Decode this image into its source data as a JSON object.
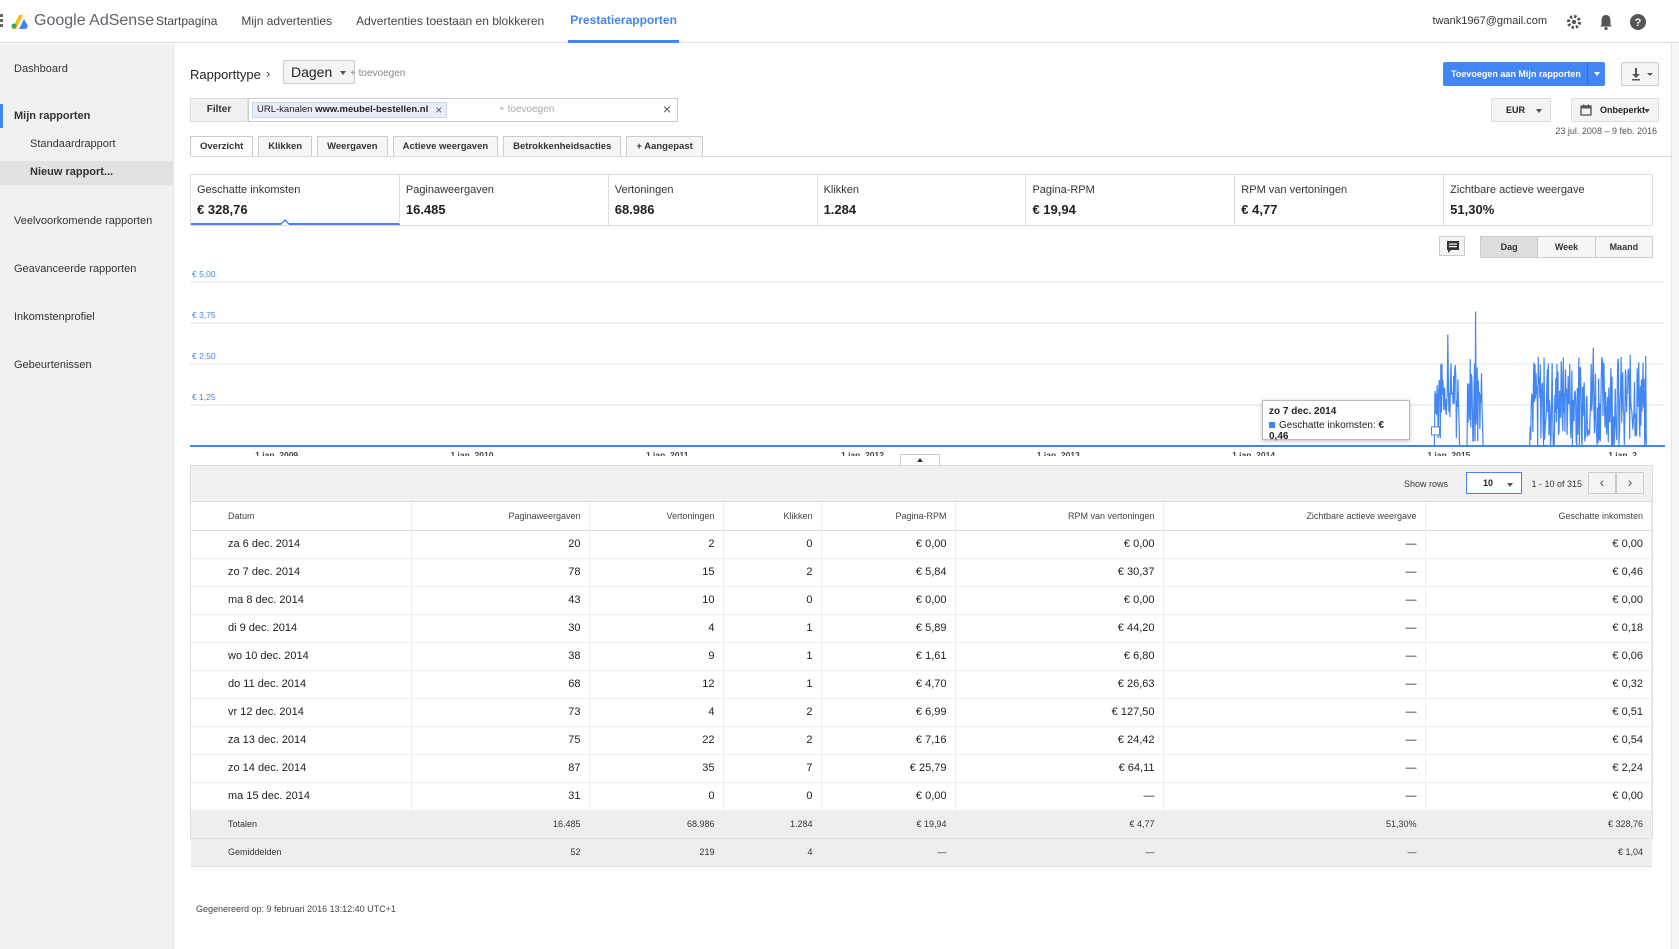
{
  "app": {
    "logo": "Google AdSense",
    "logo_icon": "adsense-logo-icon"
  },
  "nav": [
    {
      "label": "Startpagina",
      "active": false
    },
    {
      "label": "Mijn advertenties",
      "active": false
    },
    {
      "label": "Advertenties toestaan en blokkeren",
      "active": false
    },
    {
      "label": "Prestatierapporten",
      "active": true
    }
  ],
  "header": {
    "email": "twank1967@gmail.com",
    "icons": [
      "gear-icon",
      "bell-icon",
      "help-icon"
    ]
  },
  "sidebar": {
    "items": [
      {
        "label": "Dashboard"
      },
      {
        "label": "Mijn rapporten"
      },
      {
        "label": "Standaardrapport"
      },
      {
        "label": "Nieuw rapport..."
      },
      {
        "label": "Veelvoorkomende rapporten"
      },
      {
        "label": "Geavanceerde rapporten"
      },
      {
        "label": "Inkomstenprofiel"
      },
      {
        "label": "Gebeurtenissen"
      }
    ]
  },
  "report": {
    "type_label": "Rapporttype",
    "dimension": "Dagen",
    "add_label": "+ toevoegen",
    "add_to_reports": "Toevoegen aan Mijn rapporten",
    "filter_label": "Filter",
    "filter_chip_prefix": "URL-kanalen",
    "filter_chip_value": "www.meubel-bestellen.nl",
    "filter_add": "+ toevoegen",
    "currency": "EUR",
    "date_preset": "Onbeperkt",
    "date_range": "23 jul. 2008 – 9 feb. 2016"
  },
  "tabs": [
    {
      "label": "Overzicht",
      "active": true
    },
    {
      "label": "Klikken",
      "active": false
    },
    {
      "label": "Weergaven",
      "active": false
    },
    {
      "label": "Actieve weergaven",
      "active": false
    },
    {
      "label": "Betrokkenheidsacties",
      "active": false
    },
    {
      "label": "+ Aangepast",
      "active": false
    }
  ],
  "metrics": [
    {
      "label": "Geschatte inkomsten",
      "value": "€ 328,76",
      "active": true
    },
    {
      "label": "Paginaweergaven",
      "value": "16.485",
      "active": false
    },
    {
      "label": "Vertoningen",
      "value": "68.986",
      "active": false
    },
    {
      "label": "Klikken",
      "value": "1.284",
      "active": false
    },
    {
      "label": "Pagina-RPM",
      "value": "€ 19,94",
      "active": false
    },
    {
      "label": "RPM van vertoningen",
      "value": "€ 4,77",
      "active": false
    },
    {
      "label": "Zichtbare actieve weergave",
      "value": "51,30%",
      "active": false
    }
  ],
  "range_buttons": [
    {
      "label": "Dag",
      "active": true
    },
    {
      "label": "Week",
      "active": false
    },
    {
      "label": "Maand",
      "active": false
    }
  ],
  "chart_data": {
    "type": "line",
    "series": [
      {
        "name": "Geschatte inkomsten",
        "color": "#4285f4"
      }
    ],
    "x_ticks": [
      "1 jan. 2009",
      "1 jan. 2010",
      "1 jan. 2011",
      "1 jan. 2012",
      "1 jan. 2013",
      "1 jan. 2014",
      "1 jan. 2015",
      "1 jan. 2..."
    ],
    "y_ticks": [
      "€ 1,25",
      "€ 2,50",
      "€ 3,75",
      "€ 5,00"
    ],
    "ylim": [
      0,
      5
    ],
    "x_range": [
      "2008-07-23",
      "2016-02-09"
    ],
    "active_periods": [
      {
        "start": "2014-12-06",
        "end": "2015-01-20",
        "typical": [
          0.8,
          2.6
        ],
        "peak": 3.4
      },
      {
        "start": "2015-02-05",
        "end": "2015-03-05",
        "typical": [
          0.5,
          2.9
        ],
        "peak": 4.1
      },
      {
        "start": "2015-06-01",
        "end": "2016-01-05",
        "typical": [
          0.1,
          2.8
        ],
        "peak": 3.0
      }
    ],
    "tooltip": {
      "date": "zo 7 dec. 2014",
      "series": "Geschatte inkomsten",
      "value": "€ 0,46"
    },
    "grid": true
  },
  "table": {
    "show_rows_label": "Show rows",
    "rows_value": "10",
    "page_info": "1 - 10 of 315",
    "columns": [
      "Datum",
      "Paginaweergaven",
      "Vertoningen",
      "Klikken",
      "Pagina-RPM",
      "RPM van vertoningen",
      "Zichtbare actieve weergave",
      "Geschatte inkomsten"
    ],
    "rows": [
      [
        "za 6 dec. 2014",
        "20",
        "2",
        "0",
        "€ 0,00",
        "€ 0,00",
        "—",
        "€ 0,00"
      ],
      [
        "zo 7 dec. 2014",
        "78",
        "15",
        "2",
        "€ 5,84",
        "€ 30,37",
        "—",
        "€ 0,46"
      ],
      [
        "ma 8 dec. 2014",
        "43",
        "10",
        "0",
        "€ 0,00",
        "€ 0,00",
        "—",
        "€ 0,00"
      ],
      [
        "di 9 dec. 2014",
        "30",
        "4",
        "1",
        "€ 5,89",
        "€ 44,20",
        "—",
        "€ 0,18"
      ],
      [
        "wo 10 dec. 2014",
        "38",
        "9",
        "1",
        "€ 1,61",
        "€ 6,80",
        "—",
        "€ 0,06"
      ],
      [
        "do 11 dec. 2014",
        "68",
        "12",
        "1",
        "€ 4,70",
        "€ 26,63",
        "—",
        "€ 0,32"
      ],
      [
        "vr 12 dec. 2014",
        "73",
        "4",
        "2",
        "€ 6,99",
        "€ 127,50",
        "—",
        "€ 0,51"
      ],
      [
        "za 13 dec. 2014",
        "75",
        "22",
        "2",
        "€ 7,16",
        "€ 24,42",
        "—",
        "€ 0,54"
      ],
      [
        "zo 14 dec. 2014",
        "87",
        "35",
        "7",
        "€ 25,79",
        "€ 64,11",
        "—",
        "€ 2,24"
      ],
      [
        "ma 15 dec. 2014",
        "31",
        "0",
        "0",
        "€ 0,00",
        "—",
        "—",
        "€ 0,00"
      ]
    ],
    "totals": [
      "Totalen",
      "16.485",
      "68.986",
      "1.284",
      "€ 19,94",
      "€ 4,77",
      "51,30%",
      "€ 328,76"
    ],
    "averages": [
      "Gemiddelden",
      "52",
      "219",
      "4",
      "—",
      "—",
      "—",
      "€ 1,04"
    ]
  },
  "footer": {
    "generated": "Gegenereerd op: 9 februari 2016 13:12:40 UTC+1"
  }
}
